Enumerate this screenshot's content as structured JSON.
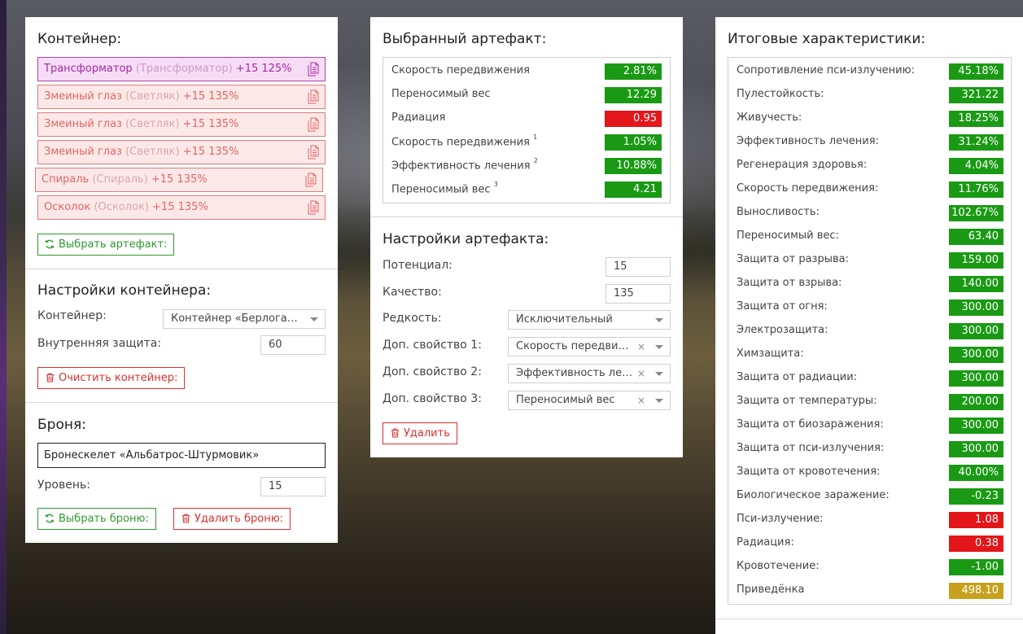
{
  "container_panel": {
    "title": "Контейнер:",
    "items": [
      {
        "name": "Трансформатор",
        "sub": "(Трансформатор)",
        "bonus": "+15 125%",
        "selected": true
      },
      {
        "name": "Змеиный глаз",
        "sub": "(Светляк)",
        "bonus": "+15 135%",
        "selected": false
      },
      {
        "name": "Змеиный глаз",
        "sub": "(Светляк)",
        "bonus": "+15 135%",
        "selected": false
      },
      {
        "name": "Змеиный глаз",
        "sub": "(Светляк)",
        "bonus": "+15 135%",
        "selected": false
      },
      {
        "name": "Спираль",
        "sub": "(Спираль)",
        "bonus": "+15 135%",
        "selected": false
      },
      {
        "name": "Осколок",
        "sub": "(Осколок)",
        "bonus": "+15 135%",
        "selected": false
      }
    ],
    "choose_artifact_label": "Выбрать артефакт:",
    "settings_title": "Настройки контейнера:",
    "container_label": "Контейнер:",
    "container_value": "Контейнер «Берлога…",
    "inner_protection_label": "Внутренняя защита:",
    "inner_protection_value": "60",
    "clear_label": "Очистить контейнер:",
    "armor_title": "Броня:",
    "armor_value": "Бронескелет «Альбатрос-Штурмовик»",
    "level_label": "Уровень:",
    "level_value": "15",
    "choose_armor_label": "Выбрать броню:",
    "delete_armor_label": "Удалить броню:"
  },
  "artifact_panel": {
    "title": "Выбранный артефакт:",
    "stats": [
      {
        "name": "Скорость передвижения",
        "sup": "",
        "value": "2.81%",
        "color": "green"
      },
      {
        "name": "Переносимый вес",
        "sup": "",
        "value": "12.29",
        "color": "green"
      },
      {
        "name": "Радиация",
        "sup": "",
        "value": "0.95",
        "color": "red"
      },
      {
        "name": "Скорость передвижения",
        "sup": "1",
        "value": "1.05%",
        "color": "green"
      },
      {
        "name": "Эффективность лечения",
        "sup": "2",
        "value": "10.88%",
        "color": "green"
      },
      {
        "name": "Переносимый вес",
        "sup": "3",
        "value": "4.21",
        "color": "green"
      }
    ],
    "settings_title": "Настройки артефакта:",
    "potential_label": "Потенциал:",
    "potential_value": "15",
    "quality_label": "Качество:",
    "quality_value": "135",
    "rarity_label": "Редкость:",
    "rarity_value": "Исключительный",
    "extra1_label": "Доп. свойство 1:",
    "extra1_value": "Скорость передви…",
    "extra2_label": "Доп. свойство 2:",
    "extra2_value": "Эффективность ле…",
    "extra3_label": "Доп. свойство 3:",
    "extra3_value": "Переносимый вес",
    "clear_x": "×",
    "delete_label": "Удалить"
  },
  "totals_panel": {
    "title": "Итоговые характеристики:",
    "stats": [
      {
        "name": "Сопротивление пси-излучению:",
        "value": "45.18%",
        "color": "green"
      },
      {
        "name": "Пулестойкость:",
        "value": "321.22",
        "color": "green"
      },
      {
        "name": "Живучесть:",
        "value": "18.25%",
        "color": "green"
      },
      {
        "name": "Эффективность лечения:",
        "value": "31.24%",
        "color": "green"
      },
      {
        "name": "Регенерация здоровья:",
        "value": "4.04%",
        "color": "green"
      },
      {
        "name": "Скорость передвижения:",
        "value": "11.76%",
        "color": "green"
      },
      {
        "name": "Выносливость:",
        "value": "102.67%",
        "color": "green"
      },
      {
        "name": "Переносимый вес:",
        "value": "63.40",
        "color": "green"
      },
      {
        "name": "Защита от разрыва:",
        "value": "159.00",
        "color": "green"
      },
      {
        "name": "Защита от взрыва:",
        "value": "140.00",
        "color": "green"
      },
      {
        "name": "Защита от огня:",
        "value": "300.00",
        "color": "green"
      },
      {
        "name": "Электрозащита:",
        "value": "300.00",
        "color": "green"
      },
      {
        "name": "Химзащита:",
        "value": "300.00",
        "color": "green"
      },
      {
        "name": "Защита от радиации:",
        "value": "300.00",
        "color": "green"
      },
      {
        "name": "Защита от температуры:",
        "value": "200.00",
        "color": "green"
      },
      {
        "name": "Защита от биозаражения:",
        "value": "300.00",
        "color": "green"
      },
      {
        "name": "Защита от пси-излучения:",
        "value": "300.00",
        "color": "green"
      },
      {
        "name": "Защита от кровотечения:",
        "value": "40.00%",
        "color": "green"
      },
      {
        "name": "Биологическое заражение:",
        "value": "-0.23",
        "color": "green"
      },
      {
        "name": "Пси-излучение:",
        "value": "1.08",
        "color": "red"
      },
      {
        "name": "Радиация:",
        "value": "0.38",
        "color": "red"
      },
      {
        "name": "Кровотечение:",
        "value": "-1.00",
        "color": "green"
      },
      {
        "name": "Приведёнка",
        "value": "498.10",
        "color": "gold"
      }
    ]
  },
  "colors": {
    "green": "#1a9a14",
    "red": "#e3161a",
    "gold": "#c7a11e",
    "selected_item": "#a52aa5",
    "item": "#e06666"
  },
  "icons": {
    "copy": "copy-icon",
    "refresh": "refresh-icon",
    "trash": "trash-icon",
    "dropdown": "chevron-down-icon",
    "clear": "close-icon"
  }
}
